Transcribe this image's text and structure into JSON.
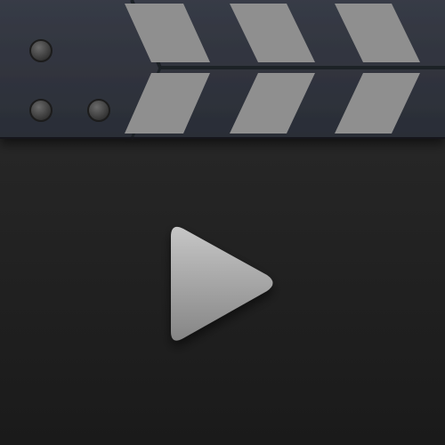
{
  "icon": {
    "semantic_name": "video-clapperboard-icon",
    "colors": {
      "body_top": "#2d2d2d",
      "body_bottom": "#1b1b1b",
      "board_dark": "#2e323c",
      "board_mid": "#353945",
      "stripe": "#8e8e8e",
      "rivet": "#4a4a4a",
      "play_light": "#c4c4c4",
      "play_dark": "#8a8a8a"
    }
  }
}
